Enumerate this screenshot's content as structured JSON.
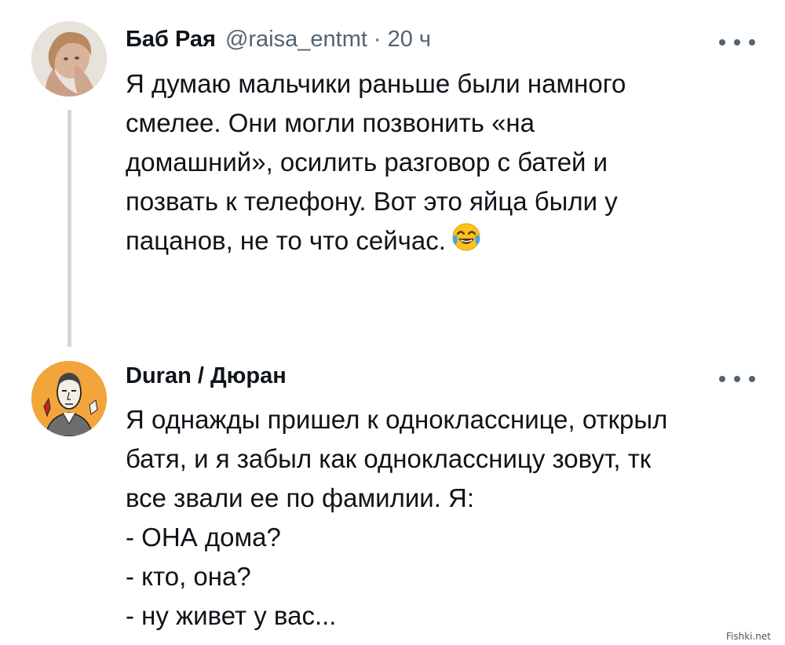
{
  "tweets": [
    {
      "author": {
        "name": "Баб Рая",
        "handle": "@raisa_entmt",
        "separator": "·",
        "time": "20 ч"
      },
      "text_lines": [
        "Я думаю мальчики раньше были намного",
        "смелее. Они могли позвонить «на",
        "домашний», осилить разговор с батей и",
        "позвать к телефону. Вот это яйца были у",
        "пацанов, не то что сейчас."
      ],
      "emoji": "face-with-tears-of-joy-icon",
      "menu_icon": "more-horizontal-icon"
    },
    {
      "author": {
        "name": "Duran / Дюран"
      },
      "text_lines": [
        "Я однажды пришел к однокласснице, открыл",
        "батя, и я забыл как одноклассницу зовут, тк",
        "все звали ее по фамилии. Я:",
        "- ОНА дома?",
        "- кто, она?",
        "- ну живет у вас..."
      ],
      "menu_icon": "more-horizontal-icon"
    }
  ],
  "colors": {
    "text_primary": "#0f1419",
    "text_secondary": "#536471",
    "thread_line": "#d2d7db",
    "avatar2_bg": "#f2a53b"
  },
  "watermark": "Fishki.net"
}
